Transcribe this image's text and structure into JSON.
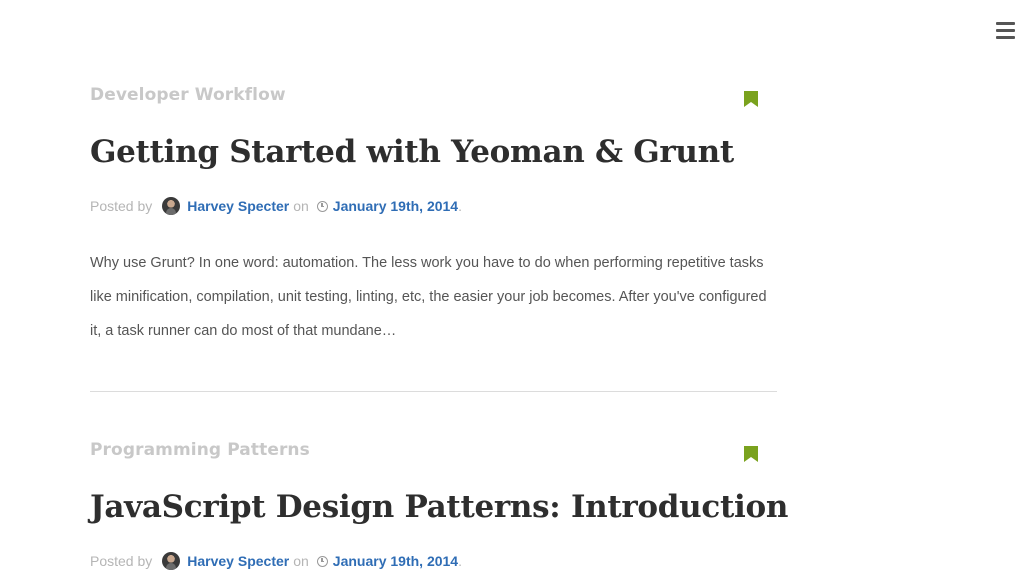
{
  "header": {
    "menu_icon": "hamburger-menu-icon"
  },
  "posts": [
    {
      "category": "Developer Workflow",
      "bookmark_icon": "bookmark-icon",
      "bookmark_color": "#7aa21e",
      "title": "Getting Started with Yeoman & Grunt",
      "posted_by_label": "Posted by",
      "author": "Harvey Specter",
      "on_label": "on",
      "date": "January 19th, 2014",
      "date_suffix": ".",
      "excerpt": "Why use Grunt? In one word: automation. The less work you have to do when performing repetitive tasks like minification, compilation, unit testing, linting, etc, the easier your job becomes. After you've configured it, a task runner can do most of that mundane…"
    },
    {
      "category": "Programming Patterns",
      "bookmark_icon": "bookmark-icon",
      "bookmark_color": "#7aa21e",
      "title": "JavaScript Design Patterns: Introduction",
      "posted_by_label": "Posted by",
      "author": "Harvey Specter",
      "on_label": "on",
      "date": "January 19th, 2014",
      "date_suffix": "."
    }
  ],
  "colors": {
    "link": "#2f6db5",
    "category": "#c8c8c8",
    "title": "#2e2e2e",
    "accent": "#7aa21e"
  }
}
